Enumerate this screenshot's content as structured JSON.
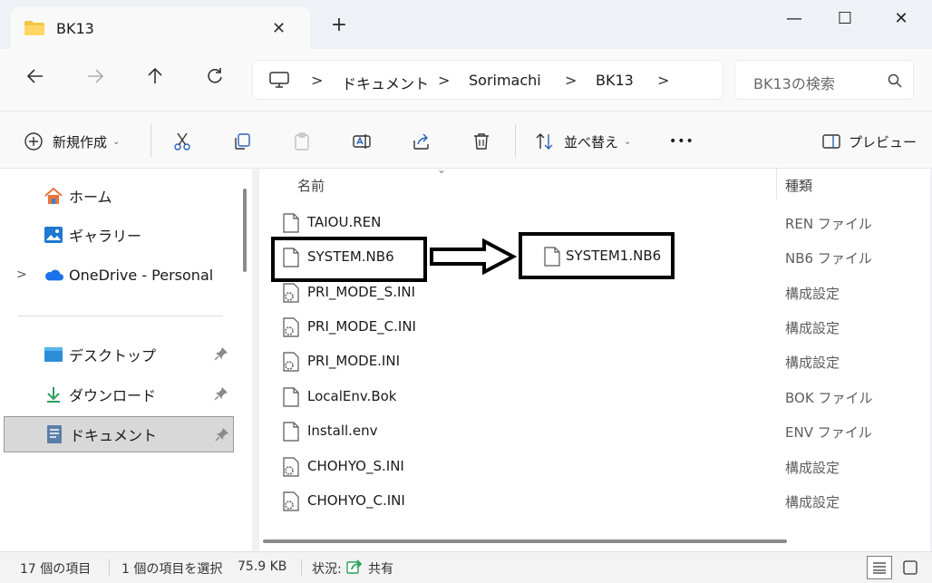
{
  "tab": {
    "title": "BK13",
    "close": "✕"
  },
  "new_tab": "+",
  "window": {
    "minimize": "—",
    "maximize": "☐",
    "close": "✕"
  },
  "address": {
    "crumbs": [
      "ドキュメント",
      "Sorimachi",
      "BK13"
    ],
    "separator": ">"
  },
  "search": {
    "placeholder": "BK13の検索"
  },
  "toolbar": {
    "new_label": "新規作成",
    "sort_label": "並べ替え",
    "more_label": "•••",
    "preview_label": "プレビュー"
  },
  "nav": {
    "items": [
      {
        "label": "ホーム",
        "icon": "home-icon"
      },
      {
        "label": "ギャラリー",
        "icon": "gallery-icon"
      },
      {
        "label": "OneDrive - Personal",
        "icon": "onedrive-icon"
      },
      {
        "label": "デスクトップ",
        "icon": "desktop-icon"
      },
      {
        "label": "ダウンロード",
        "icon": "download-icon"
      },
      {
        "label": "ドキュメント",
        "icon": "documents-icon"
      }
    ],
    "expander": ">"
  },
  "columns": {
    "name": "名前",
    "type": "種類"
  },
  "files": [
    {
      "name": "TAIOU.REN",
      "type": "REN ファイル",
      "icon": "file-icon"
    },
    {
      "name": "SYSTEM.NB6",
      "type": "NB6 ファイル",
      "icon": "file-icon"
    },
    {
      "name": "PRI_MODE_S.INI",
      "type": "構成設定",
      "icon": "config-file-icon"
    },
    {
      "name": "PRI_MODE_C.INI",
      "type": "構成設定",
      "icon": "config-file-icon"
    },
    {
      "name": "PRI_MODE.INI",
      "type": "構成設定",
      "icon": "config-file-icon"
    },
    {
      "name": "LocalEnv.Bok",
      "type": "BOK ファイル",
      "icon": "file-icon"
    },
    {
      "name": "Install.env",
      "type": "ENV ファイル",
      "icon": "file-icon"
    },
    {
      "name": "CHOHYO_S.INI",
      "type": "構成設定",
      "icon": "config-file-icon"
    },
    {
      "name": "CHOHYO_C.INI",
      "type": "構成設定",
      "icon": "config-file-icon"
    }
  ],
  "annotation": {
    "renamed_file": "SYSTEM1.NB6"
  },
  "status": {
    "count": "17 個の項目",
    "selected": "1 個の項目を選択",
    "size": "75.9 KB",
    "state_label": "状況:",
    "state_value": "共有"
  },
  "colors": {
    "accent": "#0067c0",
    "folder": "#f4c542",
    "selected_bg": "#d8d8d8"
  }
}
